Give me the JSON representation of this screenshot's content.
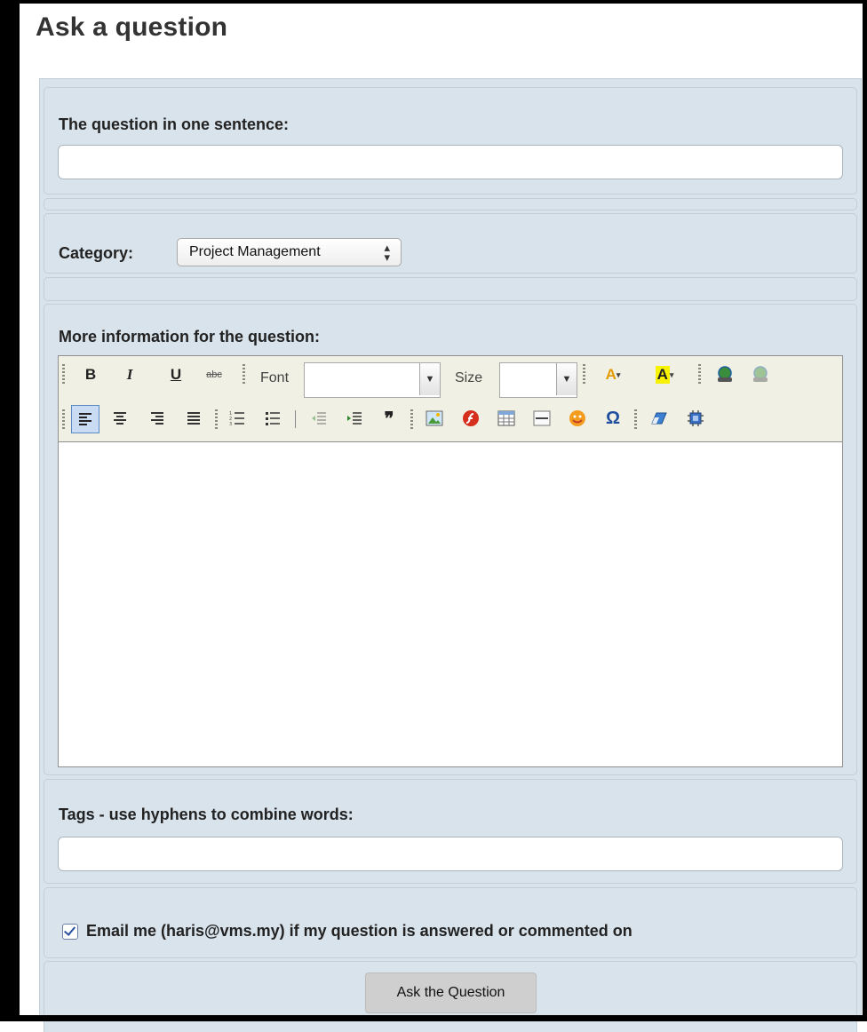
{
  "page": {
    "title": "Ask a question"
  },
  "form": {
    "question_label": "The question in one sentence:",
    "question_value": "",
    "category_label": "Category:",
    "category_selected": "Project Management",
    "more_info_label": "More information for the question:",
    "editor": {
      "font_label": "Font",
      "size_label": "Size",
      "row1_icons": [
        "bold-icon",
        "italic-icon",
        "underline-icon",
        "strikethrough-icon",
        "font-select",
        "size-select",
        "text-color-icon",
        "background-color-icon",
        "link-icon",
        "unlink-icon"
      ],
      "row2_icons": [
        "align-left-icon",
        "align-center-icon",
        "align-right-icon",
        "align-justify-icon",
        "ordered-list-icon",
        "unordered-list-icon",
        "outdent-icon",
        "indent-icon",
        "blockquote-icon",
        "image-icon",
        "flash-icon",
        "table-icon",
        "horizontal-rule-icon",
        "smiley-icon",
        "special-char-icon",
        "remove-format-icon",
        "source-icon"
      ],
      "content": ""
    },
    "tags_label": "Tags - use hyphens to combine words:",
    "tags_value": "",
    "email_label": "Email me (haris@vms.my) if my question is answered or commented on",
    "email_checked": true,
    "submit_label": "Ask the Question"
  }
}
